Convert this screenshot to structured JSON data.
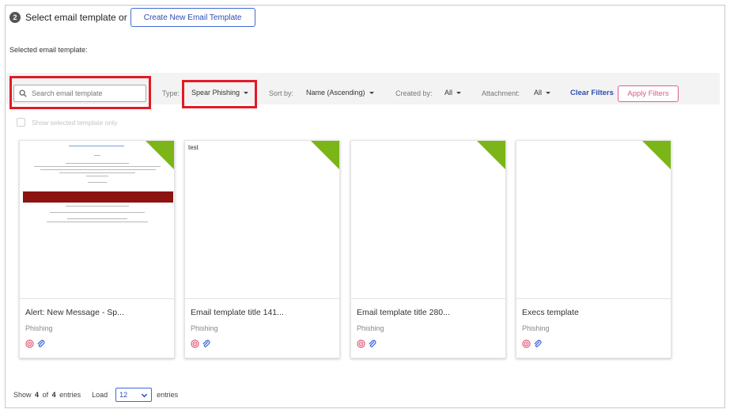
{
  "header": {
    "step_number": "2",
    "step_label": "Select email template or",
    "create_button": "Create New Email Template",
    "selected_label": "Selected email template:"
  },
  "filters": {
    "search_placeholder": "Search email template",
    "type_label": "Type:",
    "type_value": "Spear Phishing",
    "sort_label": "Sort by:",
    "sort_value": "Name (Ascending)",
    "created_label": "Created by:",
    "created_value": "All",
    "attachment_label": "Attachment:",
    "attachment_value": "All",
    "clear_label": "Clear Filters",
    "apply_label": "Apply Filters",
    "show_selected_label": "Show selected template only"
  },
  "cards": [
    {
      "title": "Alert: New Message - Sp...",
      "type": "Phishing",
      "preview_text": ""
    },
    {
      "title": "Email template title 141...",
      "type": "Phishing",
      "preview_text": "test"
    },
    {
      "title": "Email template title 280...",
      "type": "Phishing",
      "preview_text": ""
    },
    {
      "title": "Execs template",
      "type": "Phishing",
      "preview_text": ""
    }
  ],
  "footer": {
    "show_prefix": "Show",
    "shown": "4",
    "of_word": "of",
    "total": "4",
    "entries_word": "entries",
    "load_label": "Load",
    "load_value": "12",
    "entries_suffix": "entries"
  },
  "colors": {
    "accent_blue": "#2c4db3",
    "highlight_red": "#e01b24",
    "corner_green": "#7cb518",
    "apply_pink": "#d85a8a"
  },
  "icons": {
    "search": "search-icon",
    "target": "target-icon",
    "attachment": "paperclip-icon",
    "dropdown": "chevron-down-icon"
  }
}
